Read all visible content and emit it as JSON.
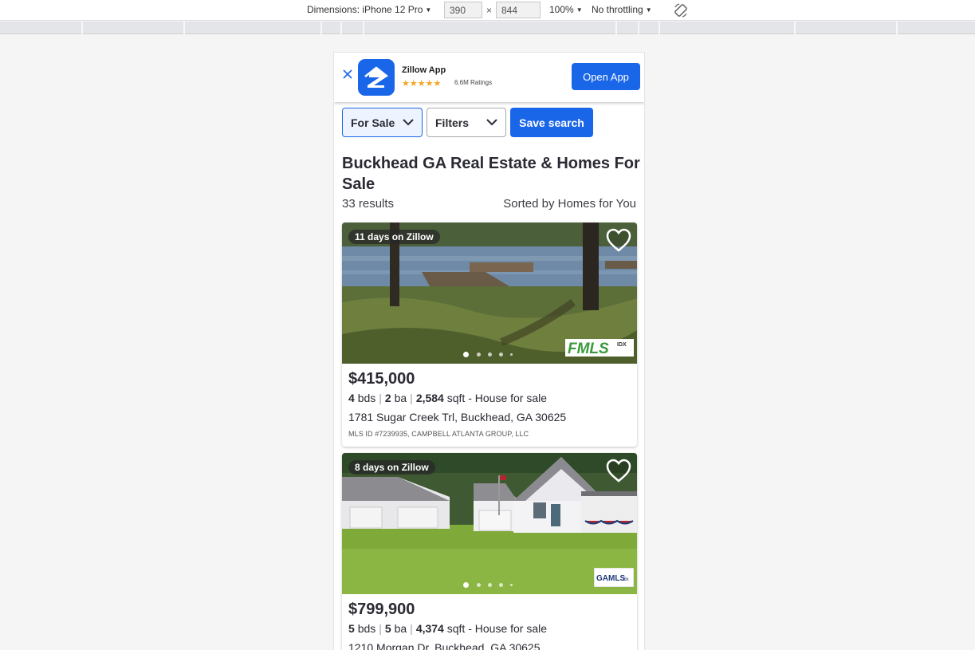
{
  "devtools": {
    "dimensions_label": "Dimensions: iPhone 12 Pro",
    "width_value": "390",
    "height_value": "844",
    "times": "×",
    "zoom": "100%",
    "throttling": "No throttling"
  },
  "app_banner": {
    "title": "Zillow App",
    "stars": "★★★★★",
    "ratings": "6.6M Ratings",
    "open_label": "Open App"
  },
  "filters": {
    "for_sale": "For Sale",
    "filters": "Filters",
    "save_search": "Save search"
  },
  "page": {
    "heading": "Buckhead GA Real Estate & Homes For Sale",
    "results": "33 results",
    "sorted": "Sorted by Homes for You"
  },
  "listings": [
    {
      "days": "11 days on Zillow",
      "price": "$415,000",
      "beds": "4",
      "beds_unit": "bds",
      "baths": "2",
      "baths_unit": "ba",
      "sqft": "2,584",
      "sqft_unit": "sqft",
      "type": "- House for sale",
      "address": "1781 Sugar Creek Trl, Buckhead, GA 30625",
      "mls": "MLS ID #7239935, CAMPBELL ATLANTA GROUP, LLC",
      "mls_logo": "FMLS",
      "photo_count_dots": 5,
      "active_dot": 0
    },
    {
      "days": "8 days on Zillow",
      "price": "$799,900",
      "beds": "5",
      "beds_unit": "bds",
      "baths": "5",
      "baths_unit": "ba",
      "sqft": "4,374",
      "sqft_unit": "sqft",
      "type": "- House for sale",
      "address": "1210 Morgan Dr, Buckhead, GA 30625",
      "mls_logo": "GAMLS",
      "photo_count_dots": 5,
      "active_dot": 0
    }
  ],
  "colors": {
    "brand_blue": "#1a66e8",
    "text": "#2a2a33"
  }
}
